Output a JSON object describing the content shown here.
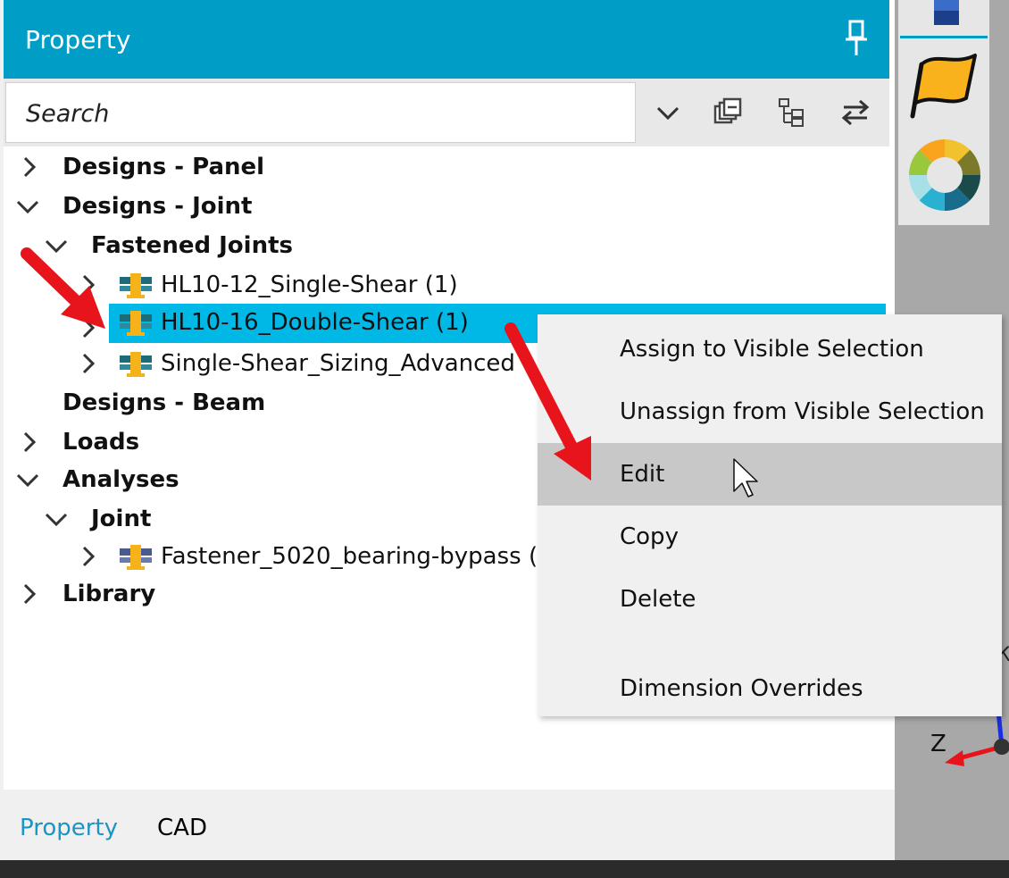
{
  "panel": {
    "title": "Property",
    "search": {
      "placeholder": "Search",
      "value": ""
    }
  },
  "tree": {
    "designs_panel": "Designs - Panel",
    "designs_joint": "Designs - Joint",
    "fastened_joints": "Fastened Joints",
    "joint_item_1": "HL10-12_Single-Shear (1)",
    "joint_item_2": "HL10-16_Double-Shear (1)",
    "joint_item_3": "Single-Shear_Sizing_Advanced (",
    "designs_beam": "Designs - Beam",
    "loads": "Loads",
    "analyses": "Analyses",
    "analyses_joint": "Joint",
    "fastener_item": "Fastener_5020_bearing-bypass (",
    "library": "Library"
  },
  "context_menu": {
    "items": [
      "Assign to Visible Selection",
      "Unassign from Visible Selection",
      "Edit",
      "Copy",
      "Delete",
      "Dimension Overrides"
    ]
  },
  "bottom_tabs": {
    "property": "Property",
    "cad": "CAD"
  },
  "axis_label": "Z",
  "colors": {
    "titlebar": "#009ec6",
    "selection": "#00b8e6",
    "active_tab": "#1a95c4",
    "arrow": "#e8141b"
  }
}
